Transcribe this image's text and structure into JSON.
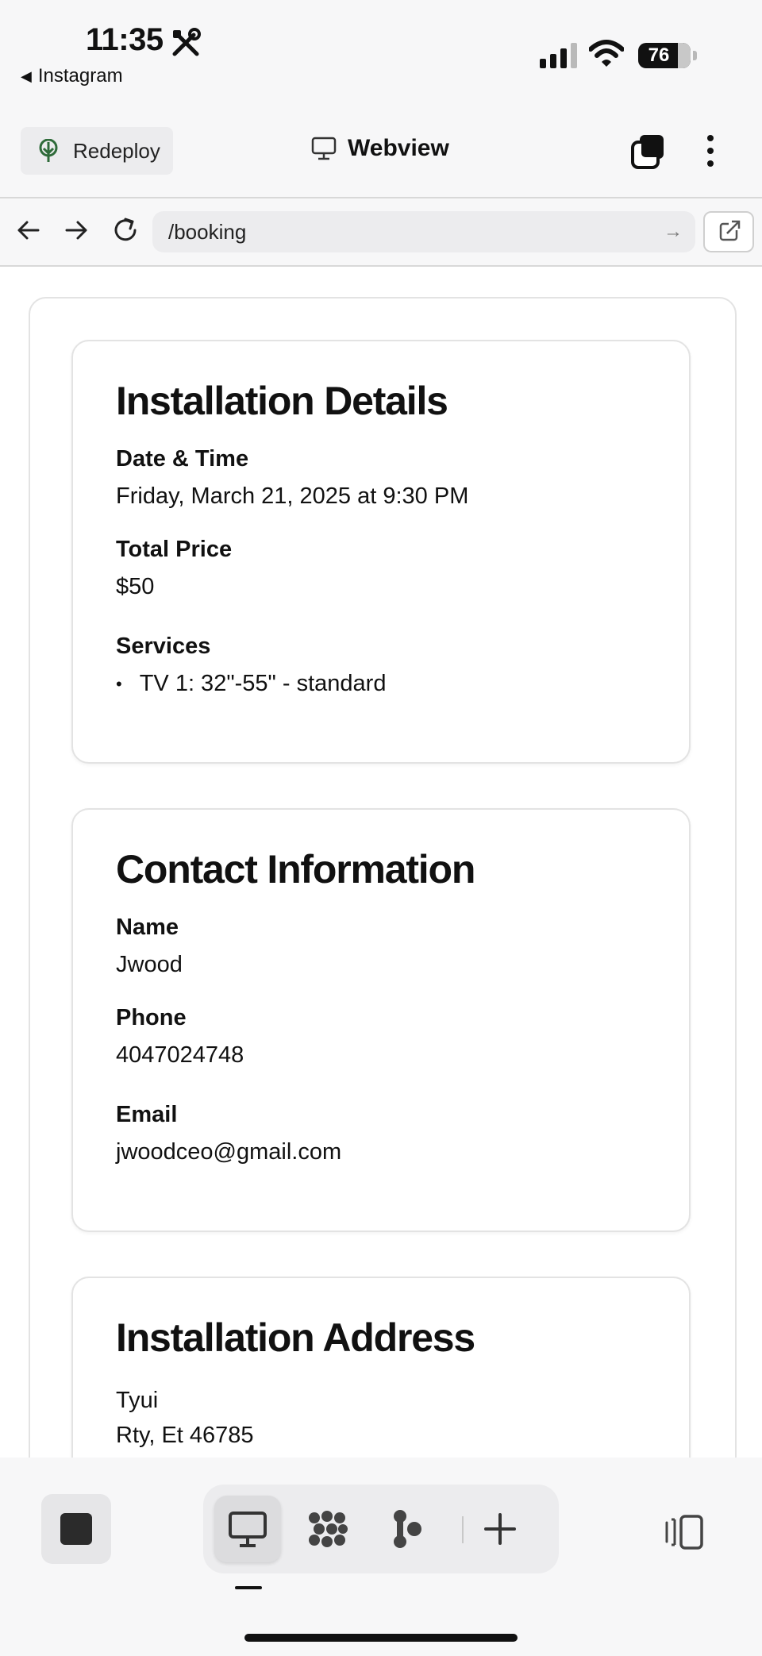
{
  "status": {
    "time": "11:35",
    "back_app": "Instagram",
    "battery": "76"
  },
  "toolbar": {
    "redeploy_label": "Redeploy",
    "title": "Webview"
  },
  "browser": {
    "url": "/booking"
  },
  "installation": {
    "heading": "Installation Details",
    "datetime_label": "Date & Time",
    "datetime_value": "Friday, March 21, 2025 at 9:30 PM",
    "price_label": "Total Price",
    "price_value": "$50",
    "services_label": "Services",
    "services": [
      "TV 1: 32\"-55\" - standard"
    ]
  },
  "contact": {
    "heading": "Contact Information",
    "name_label": "Name",
    "name_value": "Jwood",
    "phone_label": "Phone",
    "phone_value": "4047024748",
    "email_label": "Email",
    "email_value": "jwoodceo@gmail.com"
  },
  "address": {
    "heading": "Installation Address",
    "line1": "Tyui",
    "line2": "Rty, Et 46785"
  }
}
